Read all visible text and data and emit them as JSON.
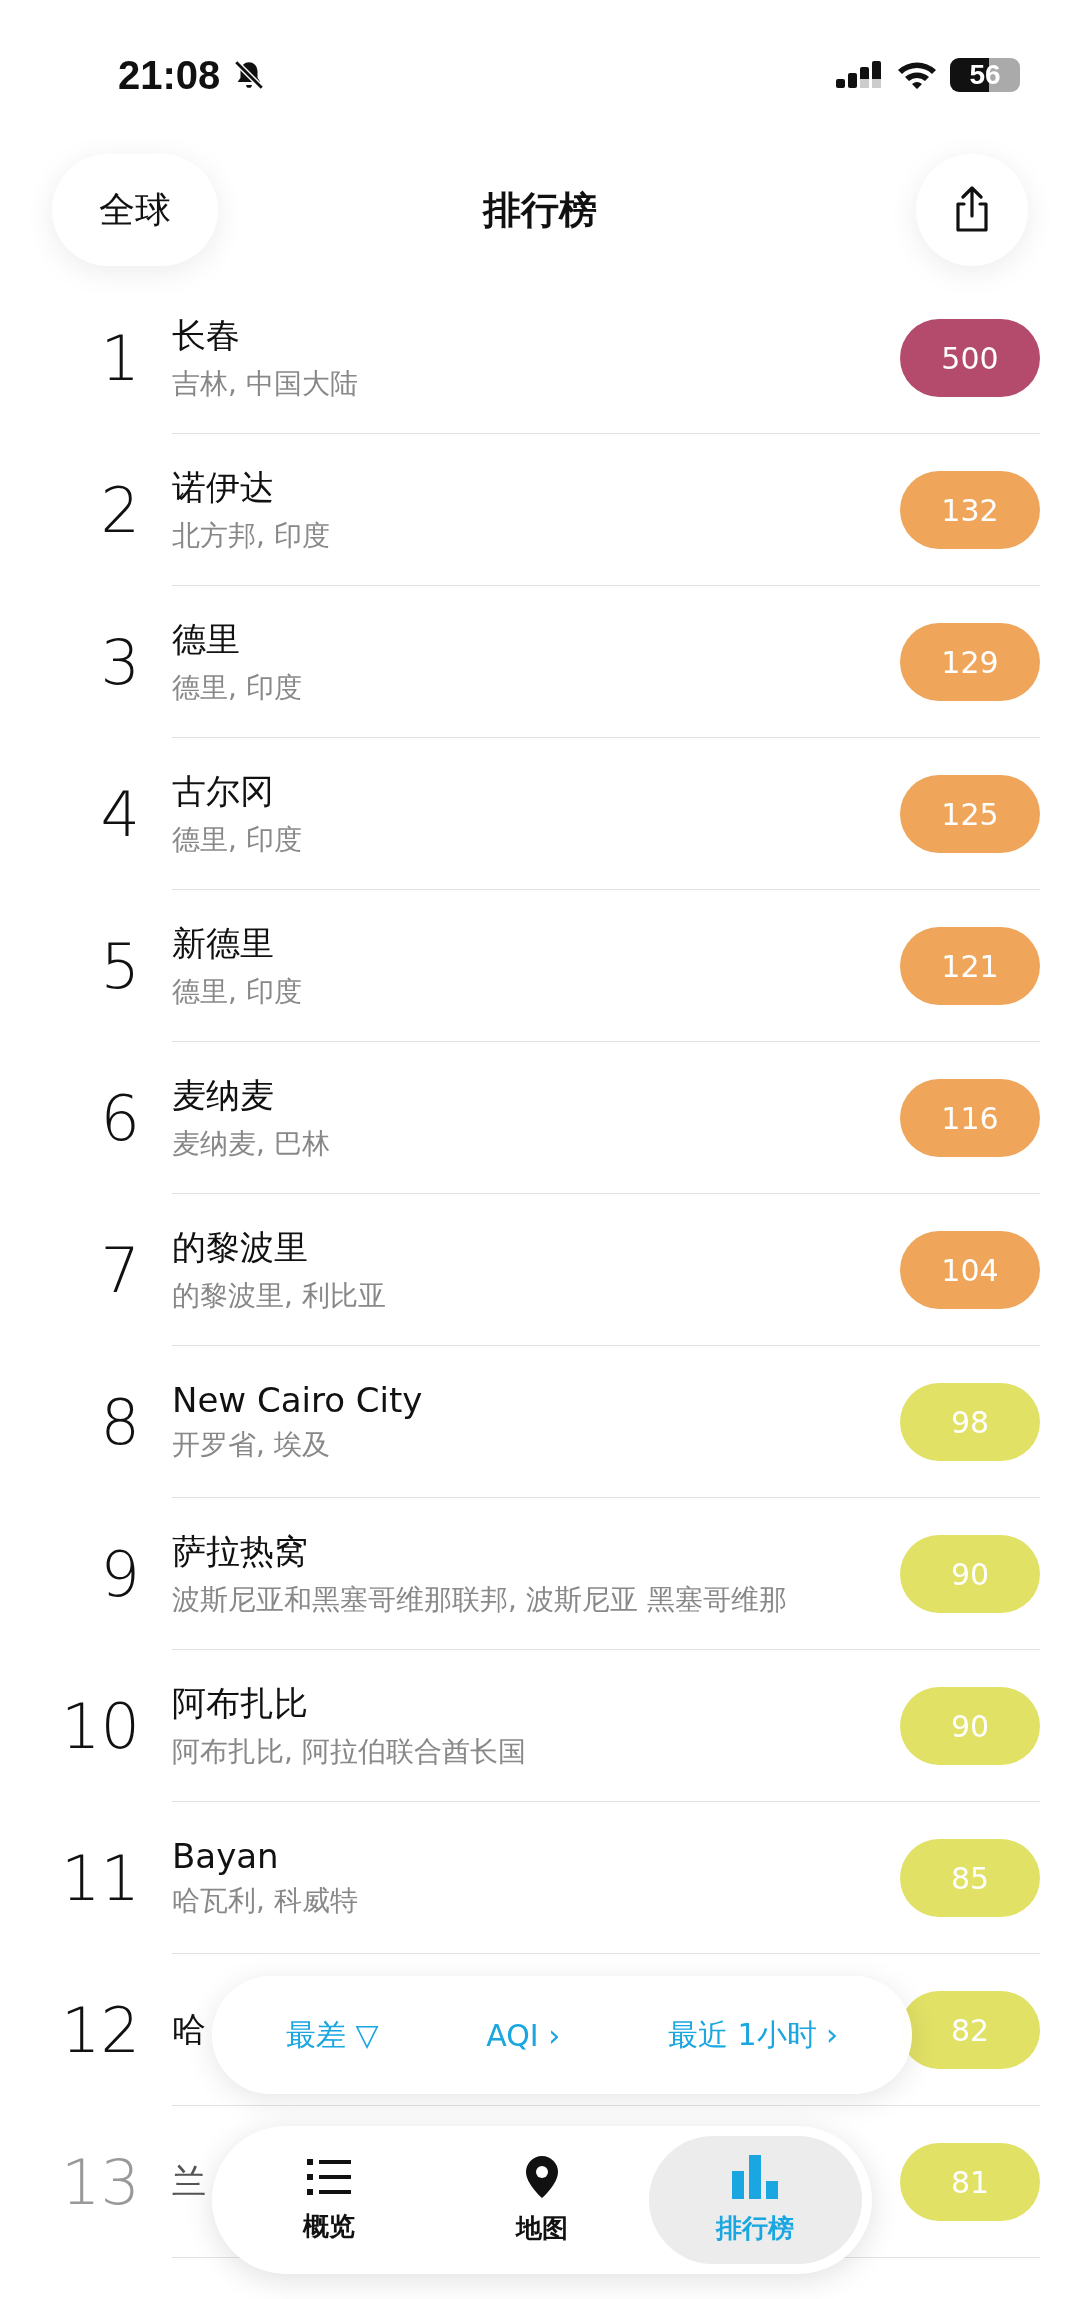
{
  "status_bar": {
    "time": "21:08",
    "battery": "56"
  },
  "nav": {
    "region_button": "全球",
    "title": "排行榜"
  },
  "rows": [
    {
      "rank": "1",
      "name": "长春",
      "place": "吉林, 中国大陆",
      "aqi": "500",
      "color": "#b44a6c"
    },
    {
      "rank": "2",
      "name": "诺伊达",
      "place": "北方邦, 印度",
      "aqi": "132",
      "color": "#efa65a"
    },
    {
      "rank": "3",
      "name": "德里",
      "place": "德里, 印度",
      "aqi": "129",
      "color": "#efa65a"
    },
    {
      "rank": "4",
      "name": "古尔冈",
      "place": "德里, 印度",
      "aqi": "125",
      "color": "#efa65a"
    },
    {
      "rank": "5",
      "name": "新德里",
      "place": "德里, 印度",
      "aqi": "121",
      "color": "#efa65a"
    },
    {
      "rank": "6",
      "name": "麦纳麦",
      "place": "麦纳麦, 巴林",
      "aqi": "116",
      "color": "#efa65a"
    },
    {
      "rank": "7",
      "name": "的黎波里",
      "place": "的黎波里, 利比亚",
      "aqi": "104",
      "color": "#efa65a"
    },
    {
      "rank": "8",
      "name": "New Cairo City",
      "place": "开罗省, 埃及",
      "aqi": "98",
      "color": "#e1e166"
    },
    {
      "rank": "9",
      "name": "萨拉热窝",
      "place": "波斯尼亚和黑塞哥维那联邦, 波斯尼亚 黑塞哥维那",
      "aqi": "90",
      "color": "#e1e166"
    },
    {
      "rank": "10",
      "name": "阿布扎比",
      "place": "阿布扎比, 阿拉伯联合酋长国",
      "aqi": "90",
      "color": "#e1e166"
    },
    {
      "rank": "11",
      "name": "Bayan",
      "place": "哈瓦利, 科威特",
      "aqi": "85",
      "color": "#e1e166"
    },
    {
      "rank": "12",
      "name": "哈",
      "aqi": "82",
      "color": "#e1e166"
    },
    {
      "rank": "13",
      "name": "兰",
      "aqi": "81",
      "color": "#e1e166"
    }
  ],
  "filters": [
    {
      "label": "最差 ▽"
    },
    {
      "label": "AQI ›"
    },
    {
      "label": "最近 1小时 ›"
    }
  ],
  "tabs": [
    {
      "label": "概览",
      "kind": "list",
      "selected": false
    },
    {
      "label": "地图",
      "kind": "pin",
      "selected": false
    },
    {
      "label": "排行榜",
      "kind": "chart",
      "selected": true
    }
  ]
}
